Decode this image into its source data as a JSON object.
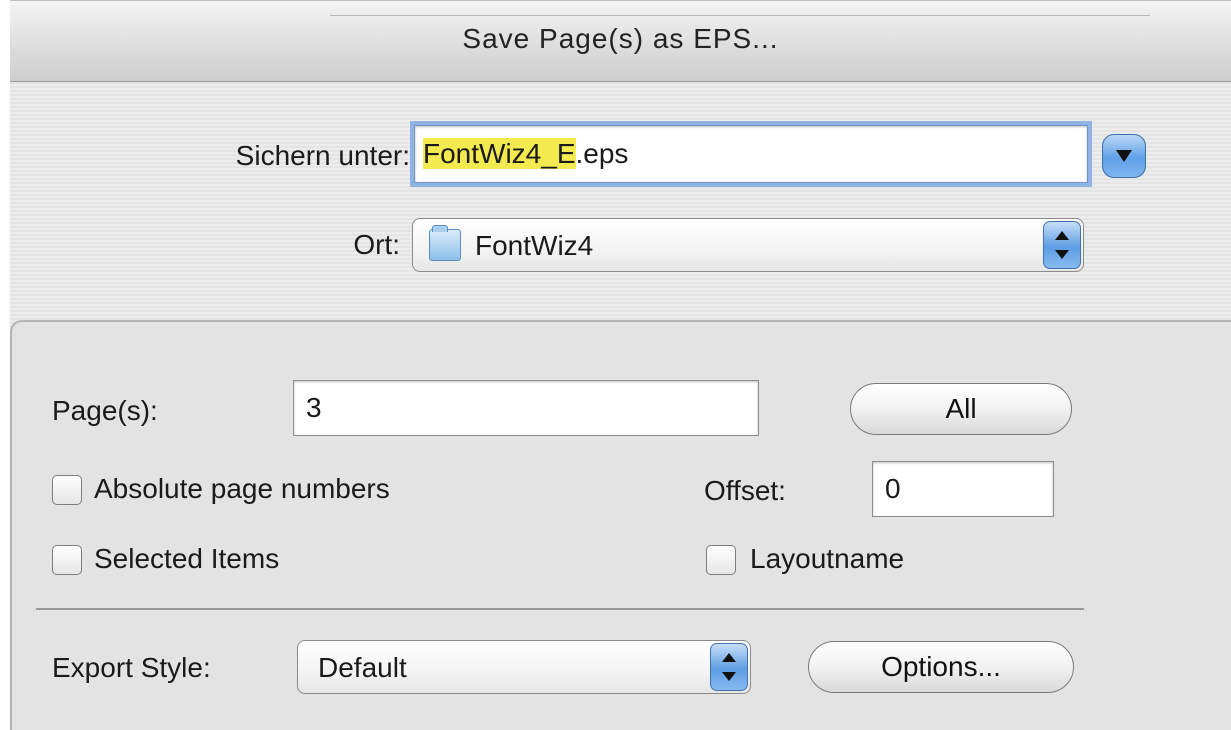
{
  "dialog": {
    "title": "Save Page(s) as EPS..."
  },
  "save": {
    "label": "Sichern unter:",
    "filename_selected": "FontWiz4_E",
    "filename_rest": ".eps"
  },
  "location": {
    "label": "Ort:",
    "value": "FontWiz4",
    "icon": "folder-icon"
  },
  "pages": {
    "label": "Page(s):",
    "value": "3",
    "all_button": "All"
  },
  "options": {
    "absolute_page_numbers": {
      "label": "Absolute page numbers",
      "checked": false
    },
    "offset": {
      "label": "Offset:",
      "value": "0"
    },
    "selected_items": {
      "label": "Selected Items",
      "checked": false
    },
    "layoutname": {
      "label": "Layoutname",
      "checked": false
    }
  },
  "export": {
    "label": "Export Style:",
    "value": "Default",
    "options_button": "Options..."
  },
  "colors": {
    "selection": "#f2ea4e",
    "accent_blue": "#5f9fe6"
  }
}
